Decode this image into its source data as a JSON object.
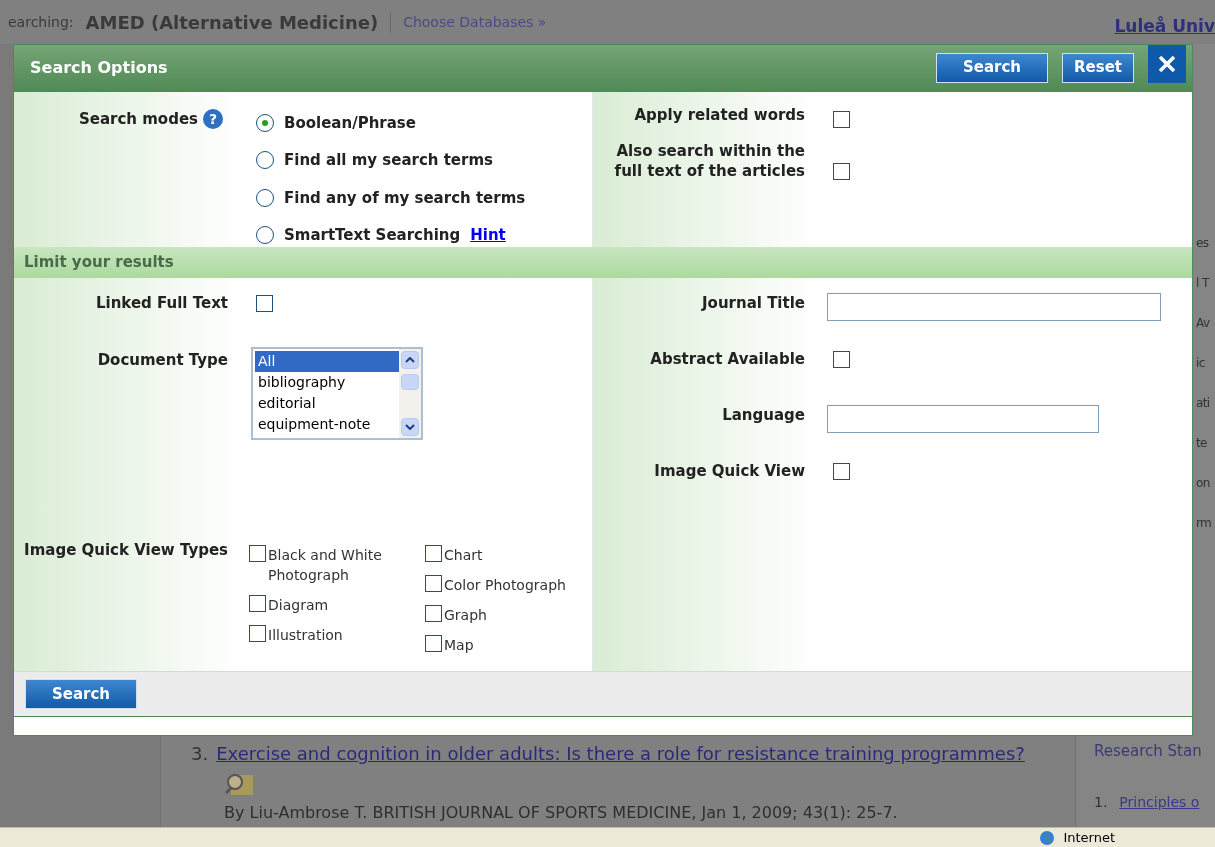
{
  "background": {
    "searching_label": "earching:",
    "database": "AMED (Alternative Medicine)",
    "choose_link": "Choose Databases »",
    "institution_link": "Luleå Univ",
    "side_fragments": [
      "es",
      "l T",
      "Av",
      "ic",
      "ati",
      "te",
      "on",
      "rm"
    ],
    "result": {
      "number": "3.",
      "title": "Exercise and cognition in older adults: Is there a role for resistance training programmes?",
      "byline": "By Liu-Ambrose T. BRITISH JOURNAL OF SPORTS MEDICINE, Jan 1, 2009; 43(1): 25-7."
    },
    "side_panel": {
      "heading": "Research Stan",
      "item_number": "1.",
      "item": "Principles o"
    }
  },
  "status_bar": {
    "zone": "Internet"
  },
  "dialog": {
    "title": "Search Options",
    "buttons": [
      "Search",
      "Reset"
    ],
    "search_modes": {
      "label": "Search modes",
      "help_icon": "?",
      "hint": "Hint",
      "options": [
        {
          "label": "Boolean/Phrase",
          "selected": true
        },
        {
          "label": "Find all my search terms",
          "selected": false
        },
        {
          "label": "Find any of my search terms",
          "selected": false
        },
        {
          "label": "SmartText Searching",
          "selected": false
        }
      ]
    },
    "expanders": [
      {
        "label": "Apply related words",
        "checked": false
      },
      {
        "label": "Also search within the full text of the articles",
        "checked": false
      }
    ],
    "limit_title": "Limit your results",
    "limits_left": [
      {
        "kind": "checkbox",
        "label": "Linked Full Text",
        "checked": false
      },
      {
        "kind": "listbox",
        "label": "Document Type",
        "options": [
          {
            "label": "All",
            "selected": true
          },
          {
            "label": "bibliography",
            "selected": false
          },
          {
            "label": "editorial",
            "selected": false
          },
          {
            "label": "equipment-note",
            "selected": false
          }
        ]
      },
      {
        "kind": "checkgroup",
        "label": "Image Quick View Types",
        "columns": [
          [
            {
              "label": "Black and White Photograph",
              "checked": false
            },
            {
              "label": "Diagram",
              "checked": false
            },
            {
              "label": "Illustration",
              "checked": false
            }
          ],
          [
            {
              "label": "Chart",
              "checked": false
            },
            {
              "label": "Color Photograph",
              "checked": false
            },
            {
              "label": "Graph",
              "checked": false
            },
            {
              "label": "Map",
              "checked": false
            }
          ]
        ]
      }
    ],
    "limits_right": [
      {
        "kind": "text",
        "label": "Journal Title"
      },
      {
        "kind": "checkbox",
        "label": "Abstract Available",
        "checked": false
      },
      {
        "kind": "text",
        "label": "Language"
      },
      {
        "kind": "checkbox",
        "label": "Image Quick View",
        "checked": false
      }
    ],
    "footer_button": "Search"
  }
}
